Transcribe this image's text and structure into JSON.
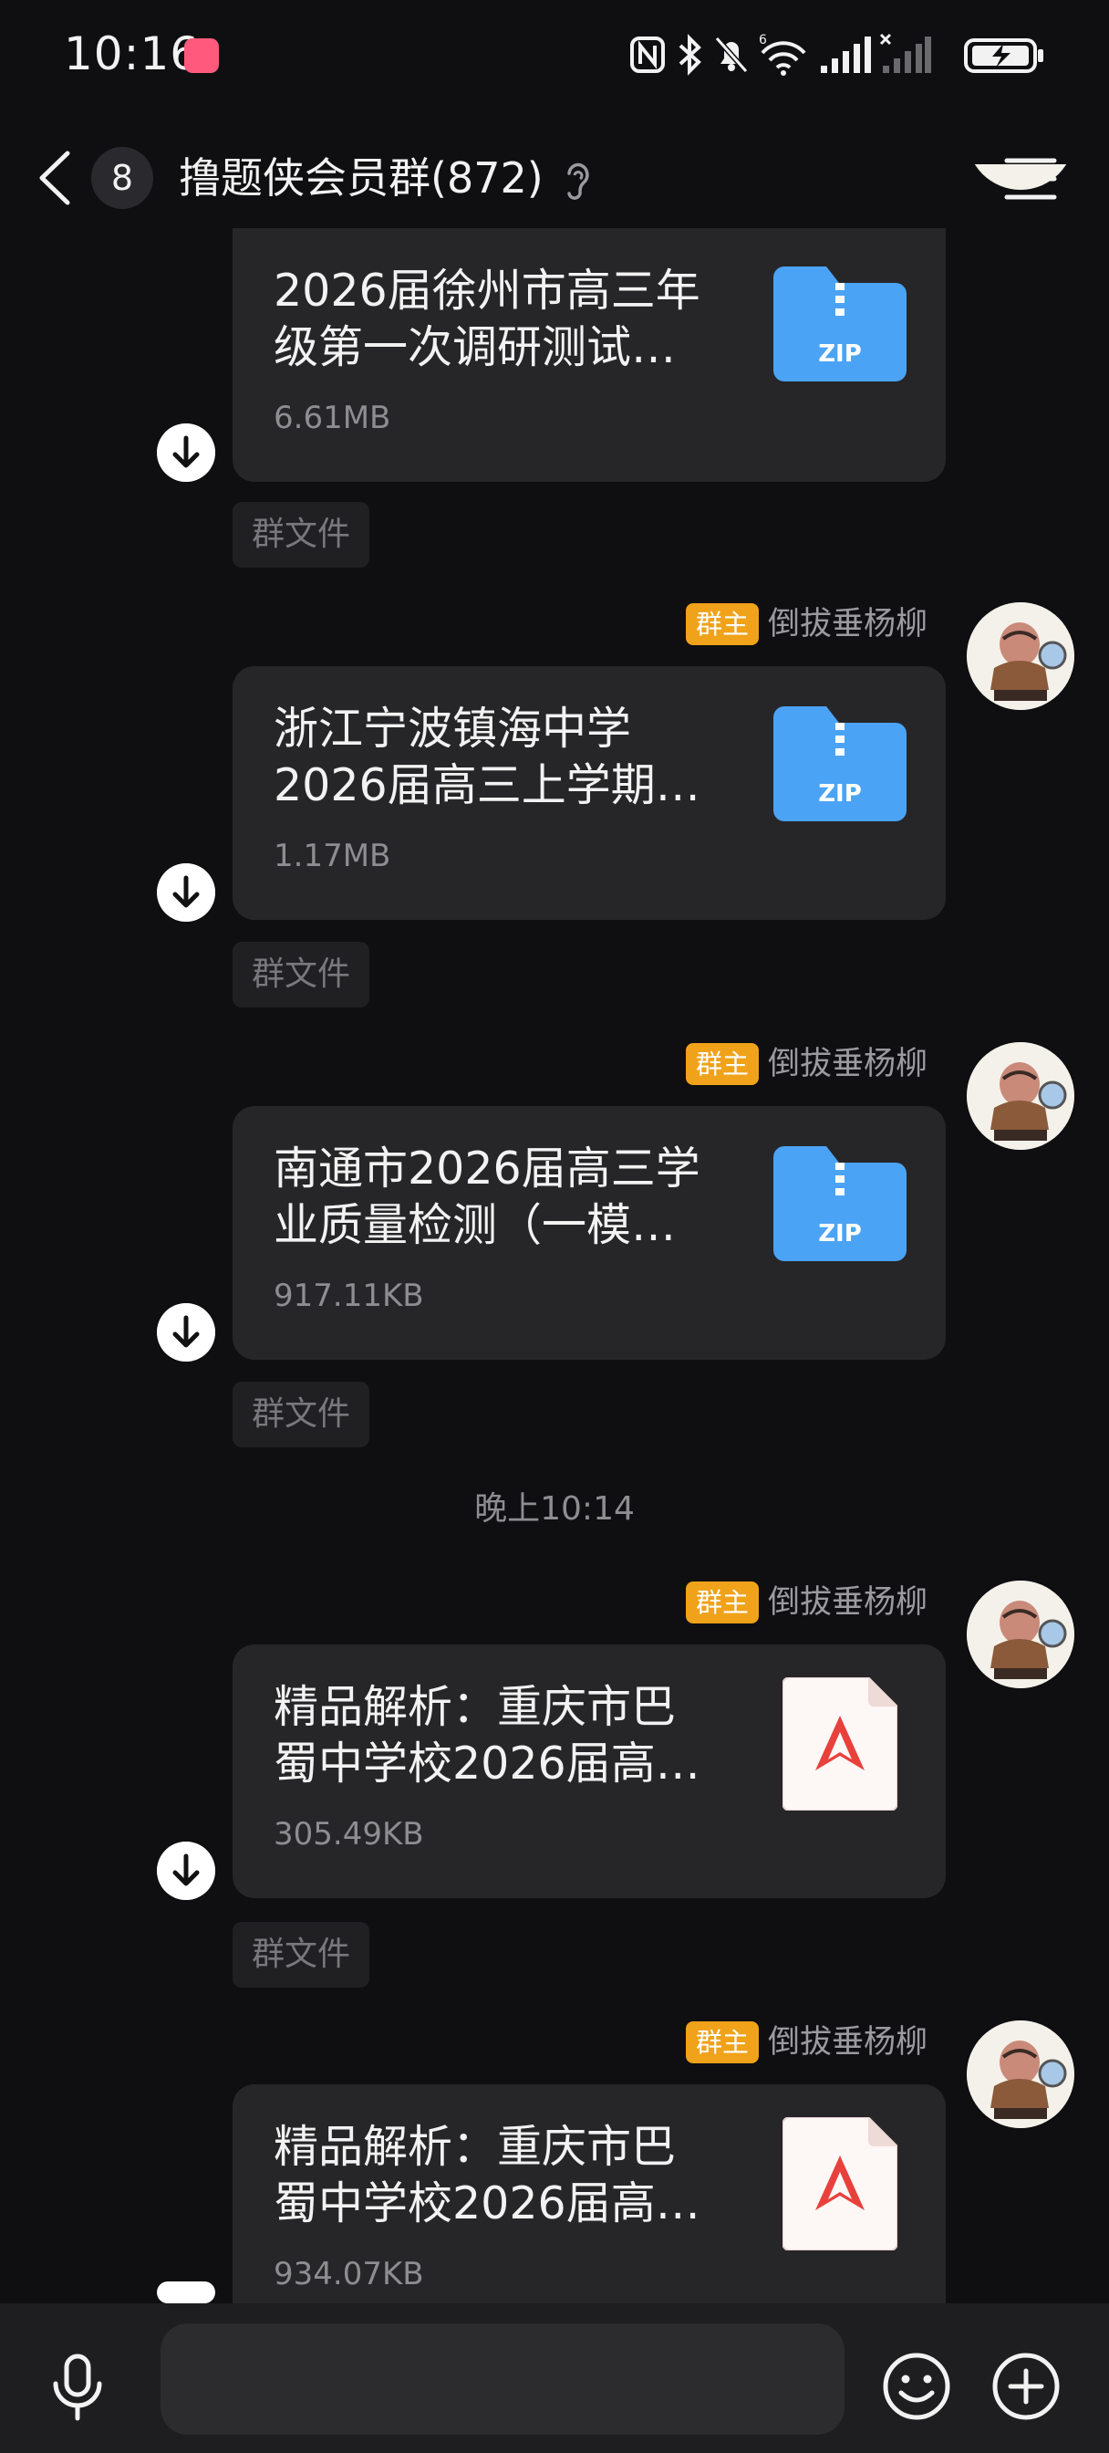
{
  "status_bar": {
    "time": "10:16",
    "icons": [
      "nfc-icon",
      "bluetooth-icon",
      "mute-bell-icon",
      "wifi-6-icon",
      "signal-icon",
      "signal-no-service-icon",
      "battery-charging-icon"
    ]
  },
  "header": {
    "unread_count": "8",
    "title": "撸题侠会员群(872)",
    "icons": [
      "back-arrow-icon",
      "ear-icon",
      "menu-icon"
    ]
  },
  "messages": [
    {
      "file_name_line1": "2026届徐州市高三年",
      "file_name_line2": "级第一次调研测试…",
      "size": "6.61MB",
      "file_type": "zip",
      "tag": "群文件"
    },
    {
      "sender_badge": "群主",
      "sender": "倒拔垂杨柳",
      "file_name_line1": "浙江宁波镇海中学",
      "file_name_line2": "2026届高三上学期…",
      "size": "1.17MB",
      "file_type": "zip",
      "tag": "群文件"
    },
    {
      "sender_badge": "群主",
      "sender": "倒拔垂杨柳",
      "file_name_line1": "南通市2026届高三学",
      "file_name_line2": "业质量检测（一模…",
      "size": "917.11KB",
      "file_type": "zip",
      "tag": "群文件"
    },
    {
      "sender_badge": "群主",
      "sender": "倒拔垂杨柳",
      "file_name_line1": "精品解析：重庆市巴",
      "file_name_line2": "蜀中学校2026届高…",
      "size": "305.49KB",
      "file_type": "pdf",
      "tag": "群文件"
    },
    {
      "sender_badge": "群主",
      "sender": "倒拔垂杨柳",
      "file_name_line1": "精品解析：重庆市巴",
      "file_name_line2": "蜀中学校2026届高…",
      "size": "934.07KB",
      "file_type": "pdf"
    }
  ],
  "timestamp": "晚上10:14",
  "zip_label": "ZIP",
  "input_bar": {
    "placeholder": "",
    "icons": [
      "microphone-icon",
      "emoji-icon",
      "plus-icon"
    ]
  },
  "colors": {
    "background": "#0f0f11",
    "bubble": "#262628",
    "owner_badge": "#f0a21a",
    "zip_blue": "#4ba3f5",
    "pdf_red": "#e8413c"
  }
}
